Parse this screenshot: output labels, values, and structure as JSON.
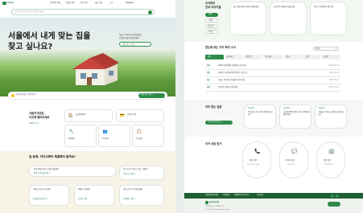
{
  "left": {
    "header": {
      "logo_text": "주거복지",
      "nav": [
        "주거복지 안내",
        "맞춤형 찾기",
        "주거 정보",
        "상담 신청",
        "소식",
        "마이페이지"
      ],
      "search_placeholder": "궁금한 주거복지 정보를 검색해 보세요"
    },
    "hero": {
      "title_line1": "서울에서 내게 맞는 집을",
      "title_line2": "찾고 싶나요?",
      "desc_line1": "서울시 주거복지 지원 정보를",
      "desc_line2": "한곳에서 쉽게 확인하세요",
      "cta_label": "내게 맞는 집 찾기 →",
      "small_question": "내 조건에 맞는 주거복지는?",
      "bar_button": "맞춤 정보 찾기 →"
    },
    "quick": {
      "title_line1": "서울주거상담,",
      "title_line2": "이곳에 물어보세요",
      "link": "자세히 보기 →",
      "items": [
        {
          "icon": "🏠",
          "label": "공공임대주택"
        },
        {
          "icon": "💳",
          "label": "주거비 지원"
        },
        {
          "icon": "🔧",
          "label": "주택개량"
        },
        {
          "icon": "👥",
          "label": "주거상담"
        },
        {
          "icon": "📋",
          "label": "주거급여"
        },
        {
          "icon": "🏢",
          "label": "청년주택"
        }
      ]
    },
    "faq": {
      "title": "집 문제, 어디서부터 해결해야 할까요?",
      "cards": [
        {
          "q": "전세 계약을 앞두고 있어 불안해요",
          "a": "계약 전 확인할 사항 →"
        },
        {
          "q": "내 소득으로 받을 수 있는 지원은?",
          "a": "지원 조건 확인 →"
        },
        {
          "q": "이사할 집을 찾고 있어요",
          "a": "공공임대 알아보기 →"
        },
        {
          "q": "월세가 부담돼요",
          "a": "주거비 지원 →"
        },
        {
          "q": "집이 낡아 수리가 필요해요",
          "a": "주택개량 지원 →"
        }
      ]
    }
  },
  "right": {
    "top": {
      "title_line1": "주거복지",
      "title_line2": "안내 이야기들",
      "chips": [
        "전체",
        "청년",
        "신혼부부",
        "어르신"
      ],
      "cards": [
        {
          "text": "청년 월세 지원, 이렇게 신청하세요"
        },
        {
          "text": "신혼부부 전세자금 대출 안내"
        },
        {
          "text": "어르신 주택개량 지원 사업"
        }
      ]
    },
    "news": {
      "title": "한눈에 보는 주거 복지 소식",
      "select": "최신순",
      "tabs": [
        "전체",
        "공지사항",
        "모집공고",
        "보도자료",
        "행사",
        "교육",
        "자료실"
      ],
      "rows": [
        {
          "tag": "공지",
          "text": "2025년 청년월세 지원사업 신청 안내",
          "date": "2025.06.10"
        },
        {
          "tag": "모집",
          "text": "2025년 공공임대주택 입주자 모집 공고",
          "date": "2025.06.05"
        },
        {
          "tag": "보도",
          "text": "서울시 주거안심 종합센터 운영 확대",
          "date": "2025.05.28"
        },
        {
          "tag": "행사",
          "text": "주거복지 박람회 개최 안내",
          "date": "2025.05.20"
        }
      ]
    },
    "faq2": {
      "title_line1": "자주 묻는 질문",
      "title_line2": "",
      "button": "더 많은 질문 보기 →",
      "cards": [
        {
          "cat": "주거급여",
          "text": "주거급여 신청 자격은 어떻게 되나요?"
        },
        {
          "cat": "공공임대",
          "text": "공공임대주택 입주 순서는 어떻게 정해지나요?"
        },
        {
          "cat": "전세사기",
          "text": "전세사기 피해 시 어디에 상담하나요?"
        }
      ]
    },
    "consult": {
      "title": "주거 상담 받기",
      "items": [
        {
          "icon": "📞",
          "label": "전화 상담",
          "sub": "평일 09:00~18:00"
        },
        {
          "icon": "💬",
          "label": "온라인 상담",
          "sub": "24시간 접수"
        },
        {
          "icon": "🏢",
          "label": "방문 상담",
          "sub": "주거안심센터"
        }
      ]
    },
    "footer": {
      "links": [
        "개인정보처리방침",
        "이용약관",
        "이메일무단수집거부",
        "사이트맵"
      ],
      "logo": "서울주거포털",
      "address": "서울특별시 중구 세종대로 110",
      "copyright": "© Seoul Metropolitan Government"
    }
  }
}
